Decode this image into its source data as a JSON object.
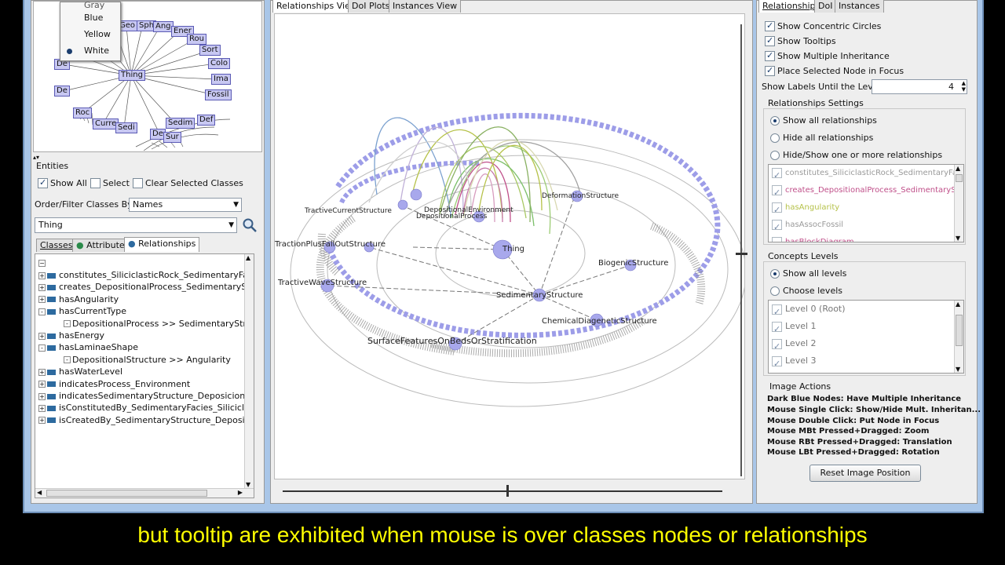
{
  "color_menu": {
    "items": [
      "Gray",
      "Blue",
      "Yellow",
      "White"
    ],
    "selected": "White"
  },
  "overview_nodes": [
    "Geo",
    "Sph",
    "Ang",
    "Ener",
    "Rou",
    "Sort",
    "Colo",
    "Ima",
    "Fossil",
    "De",
    "De",
    "Thing",
    "Roc",
    "Curre",
    "Sedi",
    "Sedim",
    "Def",
    "De",
    "Sur"
  ],
  "entities": {
    "title": "Entities",
    "show_all": "Show All",
    "select": "Select",
    "clear_selected": "Clear Selected Classes",
    "order_label": "Order/Filter Classes By:",
    "order_value": "Names",
    "search_value": "Thing"
  },
  "left_tabs": [
    "Classes",
    "Attributes",
    "Relationships"
  ],
  "tree_items": [
    {
      "toggle": "+",
      "label": "constitutes_SiliciclasticRock_SedimentaryFacies",
      "indent": 0
    },
    {
      "toggle": "+",
      "label": "creates_DepositionalProcess_SedimentaryStructu",
      "indent": 0
    },
    {
      "toggle": "+",
      "label": "hasAngularity",
      "indent": 0
    },
    {
      "toggle": "-",
      "label": "hasCurrentType",
      "indent": 0
    },
    {
      "toggle": "-",
      "label": "DepositionalProcess  >>  SedimentaryStructur",
      "indent": 1
    },
    {
      "toggle": "+",
      "label": "hasEnergy",
      "indent": 0
    },
    {
      "toggle": "-",
      "label": "hasLaminaeShape",
      "indent": 0
    },
    {
      "toggle": "-",
      "label": "DepositionalStructure  >>  Angularity",
      "indent": 1
    },
    {
      "toggle": "+",
      "label": "hasWaterLevel",
      "indent": 0
    },
    {
      "toggle": "+",
      "label": "indicatesProcess_Environment",
      "indent": 0
    },
    {
      "toggle": "+",
      "label": "indicatesSedimentaryStructure_DeposicionalProce",
      "indent": 0
    },
    {
      "toggle": "+",
      "label": "isConstitutedBy_SedimentaryFacies_SiliciclasticRo",
      "indent": 0
    },
    {
      "toggle": "+",
      "label": "isCreatedBy_SedimentaryStructure_DepositionalP",
      "indent": 0
    }
  ],
  "mid_tabs": [
    "Relationships View",
    "DoI Plots",
    "Instances View"
  ],
  "graph_labels": {
    "thing": "Thing",
    "sedimentary": "SedimentaryStructure",
    "biogenic": "BiogenicStructure",
    "chemical": "ChemicalDiageneticStructure",
    "surface": "SurfaceFeaturesOnBedsOrStratification",
    "tractive_wave": "TractiveWaveStructure",
    "traction": "TractionPlusFallOutStructure",
    "tractive_current": "TractiveCurrentStructure",
    "deformation": "DeformationStructure",
    "depositional_env": "DepositionalEnvironment",
    "depositional_proc": "DepositionalProcess"
  },
  "right_tabs": [
    "Relationships",
    "DoI",
    "Instances"
  ],
  "options": {
    "concentric": "Show Concentric Circles",
    "tooltips": "Show Tooltips",
    "multiple_inheritance": "Show Multiple Inheritance",
    "place_selected": "Place Selected Node in Focus",
    "labels_until": "Show Labels Until the Level",
    "level_value": "4"
  },
  "relationships_settings": {
    "title": "Relationships Settings",
    "show_all": "Show all relationships",
    "hide_all": "Hide all relationships",
    "hide_show": "Hide/Show one or more relationships",
    "list": [
      {
        "label": "constitutes_SiliciclasticRock_SedimentaryFacies",
        "color": "#9a9a9a"
      },
      {
        "label": "creates_DepositionalProcess_SedimentaryStructu",
        "color": "#c0508a"
      },
      {
        "label": "hasAngularity",
        "color": "#b6c24a"
      },
      {
        "label": "hasAssocFossil",
        "color": "#9a9a9a"
      },
      {
        "label": "hasBlockDiagram",
        "color": "#c0508a"
      }
    ]
  },
  "concepts_levels": {
    "title": "Concepts Levels",
    "show_all": "Show all levels",
    "choose": "Choose levels",
    "list": [
      "Level 0 (Root)",
      "Level 1",
      "Level 2",
      "Level 3"
    ]
  },
  "image_actions": {
    "title": "Image Actions",
    "lines": [
      "Dark Blue Nodes: Have Multiple Inheritance",
      "Mouse Single Click: Show/Hide Mult. Inheritan...",
      "Mouse Double Click: Put Node in Focus",
      "Mouse MBt Pressed+Dragged: Zoom",
      "Mouse RBt Pressed+Dragged: Translation",
      "Mouse LBt Pressed+Dragged: Rotation"
    ],
    "reset_button": "Reset Image Position"
  },
  "subtitle": "but tooltip are exhibited when mouse is over classes nodes or relationships"
}
